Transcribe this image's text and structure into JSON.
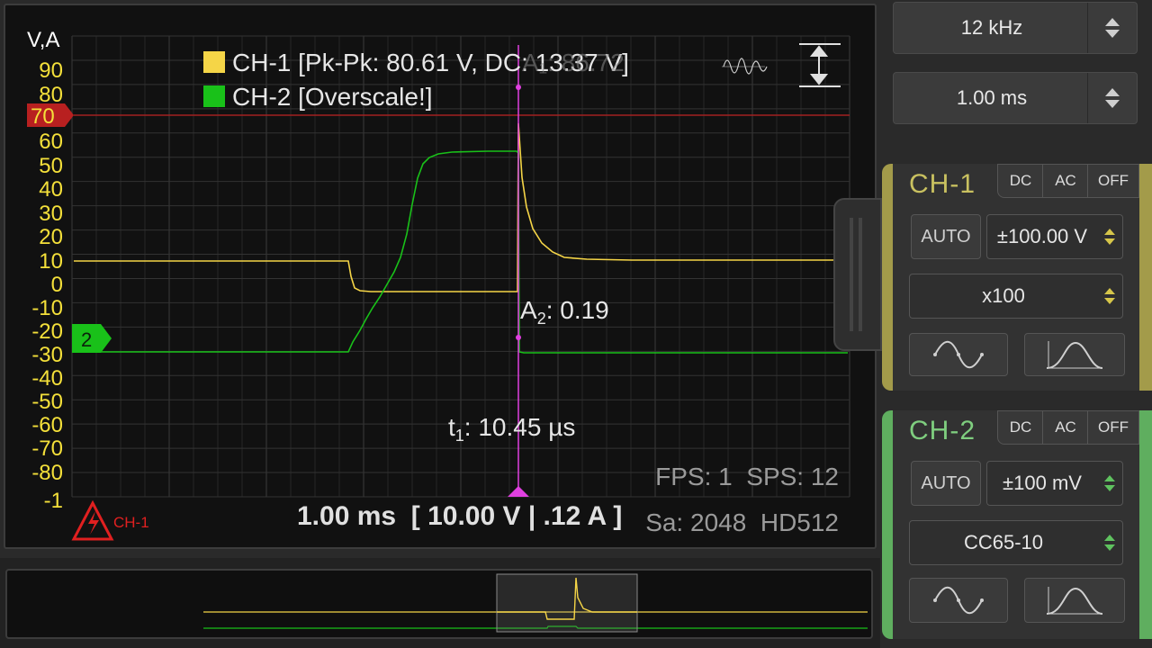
{
  "scope": {
    "unit_label": "V,A",
    "y_ticks": [
      "90",
      "80",
      "70",
      "60",
      "50",
      "40",
      "30",
      "20",
      "10",
      "0",
      "-10",
      "-20",
      "-30",
      "-40",
      "-50",
      "-60",
      "-70",
      "-80",
      "-1"
    ],
    "legend": [
      {
        "label": "CH-1 [Pk-Pk: 80.61 V, DC: 13.37 V]",
        "color": "#f5d547"
      },
      {
        "label": "CH-2 [Overscale!]",
        "color": "#19c119"
      }
    ],
    "cursor_ghost": "A₁: 86.72",
    "cursor_a2_prefix": "A",
    "cursor_a2_sub": "2",
    "cursor_a2_value": ": 0.19",
    "cursor_t1_prefix": "t",
    "cursor_t1_sub": "1",
    "cursor_t1_value": ": 10.45 µs",
    "trigger_level_marker": "70",
    "ch2_marker": "2",
    "stats": "FPS: 1  SPS: 12",
    "scale_readout": "1.00 ms  [ 10.00 V | .12 A ]",
    "sample_info": "Sa: 2048  HD512",
    "alert_label": "CH-1",
    "colors": {
      "ch1": "#f5d547",
      "ch2": "#19c119",
      "cursor": "#e040e0",
      "trigger": "#b02020"
    }
  },
  "controls": {
    "sample_rate": "12 kHz",
    "timebase": "1.00 ms"
  },
  "ch1": {
    "title": "CH-1",
    "coupling": [
      "DC",
      "AC",
      "OFF"
    ],
    "auto": "AUTO",
    "range": "±100.00 V",
    "probe": "x100",
    "accent": "#c9c160"
  },
  "ch2": {
    "title": "CH-2",
    "coupling": [
      "DC",
      "AC",
      "OFF"
    ],
    "auto": "AUTO",
    "range": "±100 mV",
    "probe": "CC65-10",
    "accent": "#7fce7f"
  }
}
